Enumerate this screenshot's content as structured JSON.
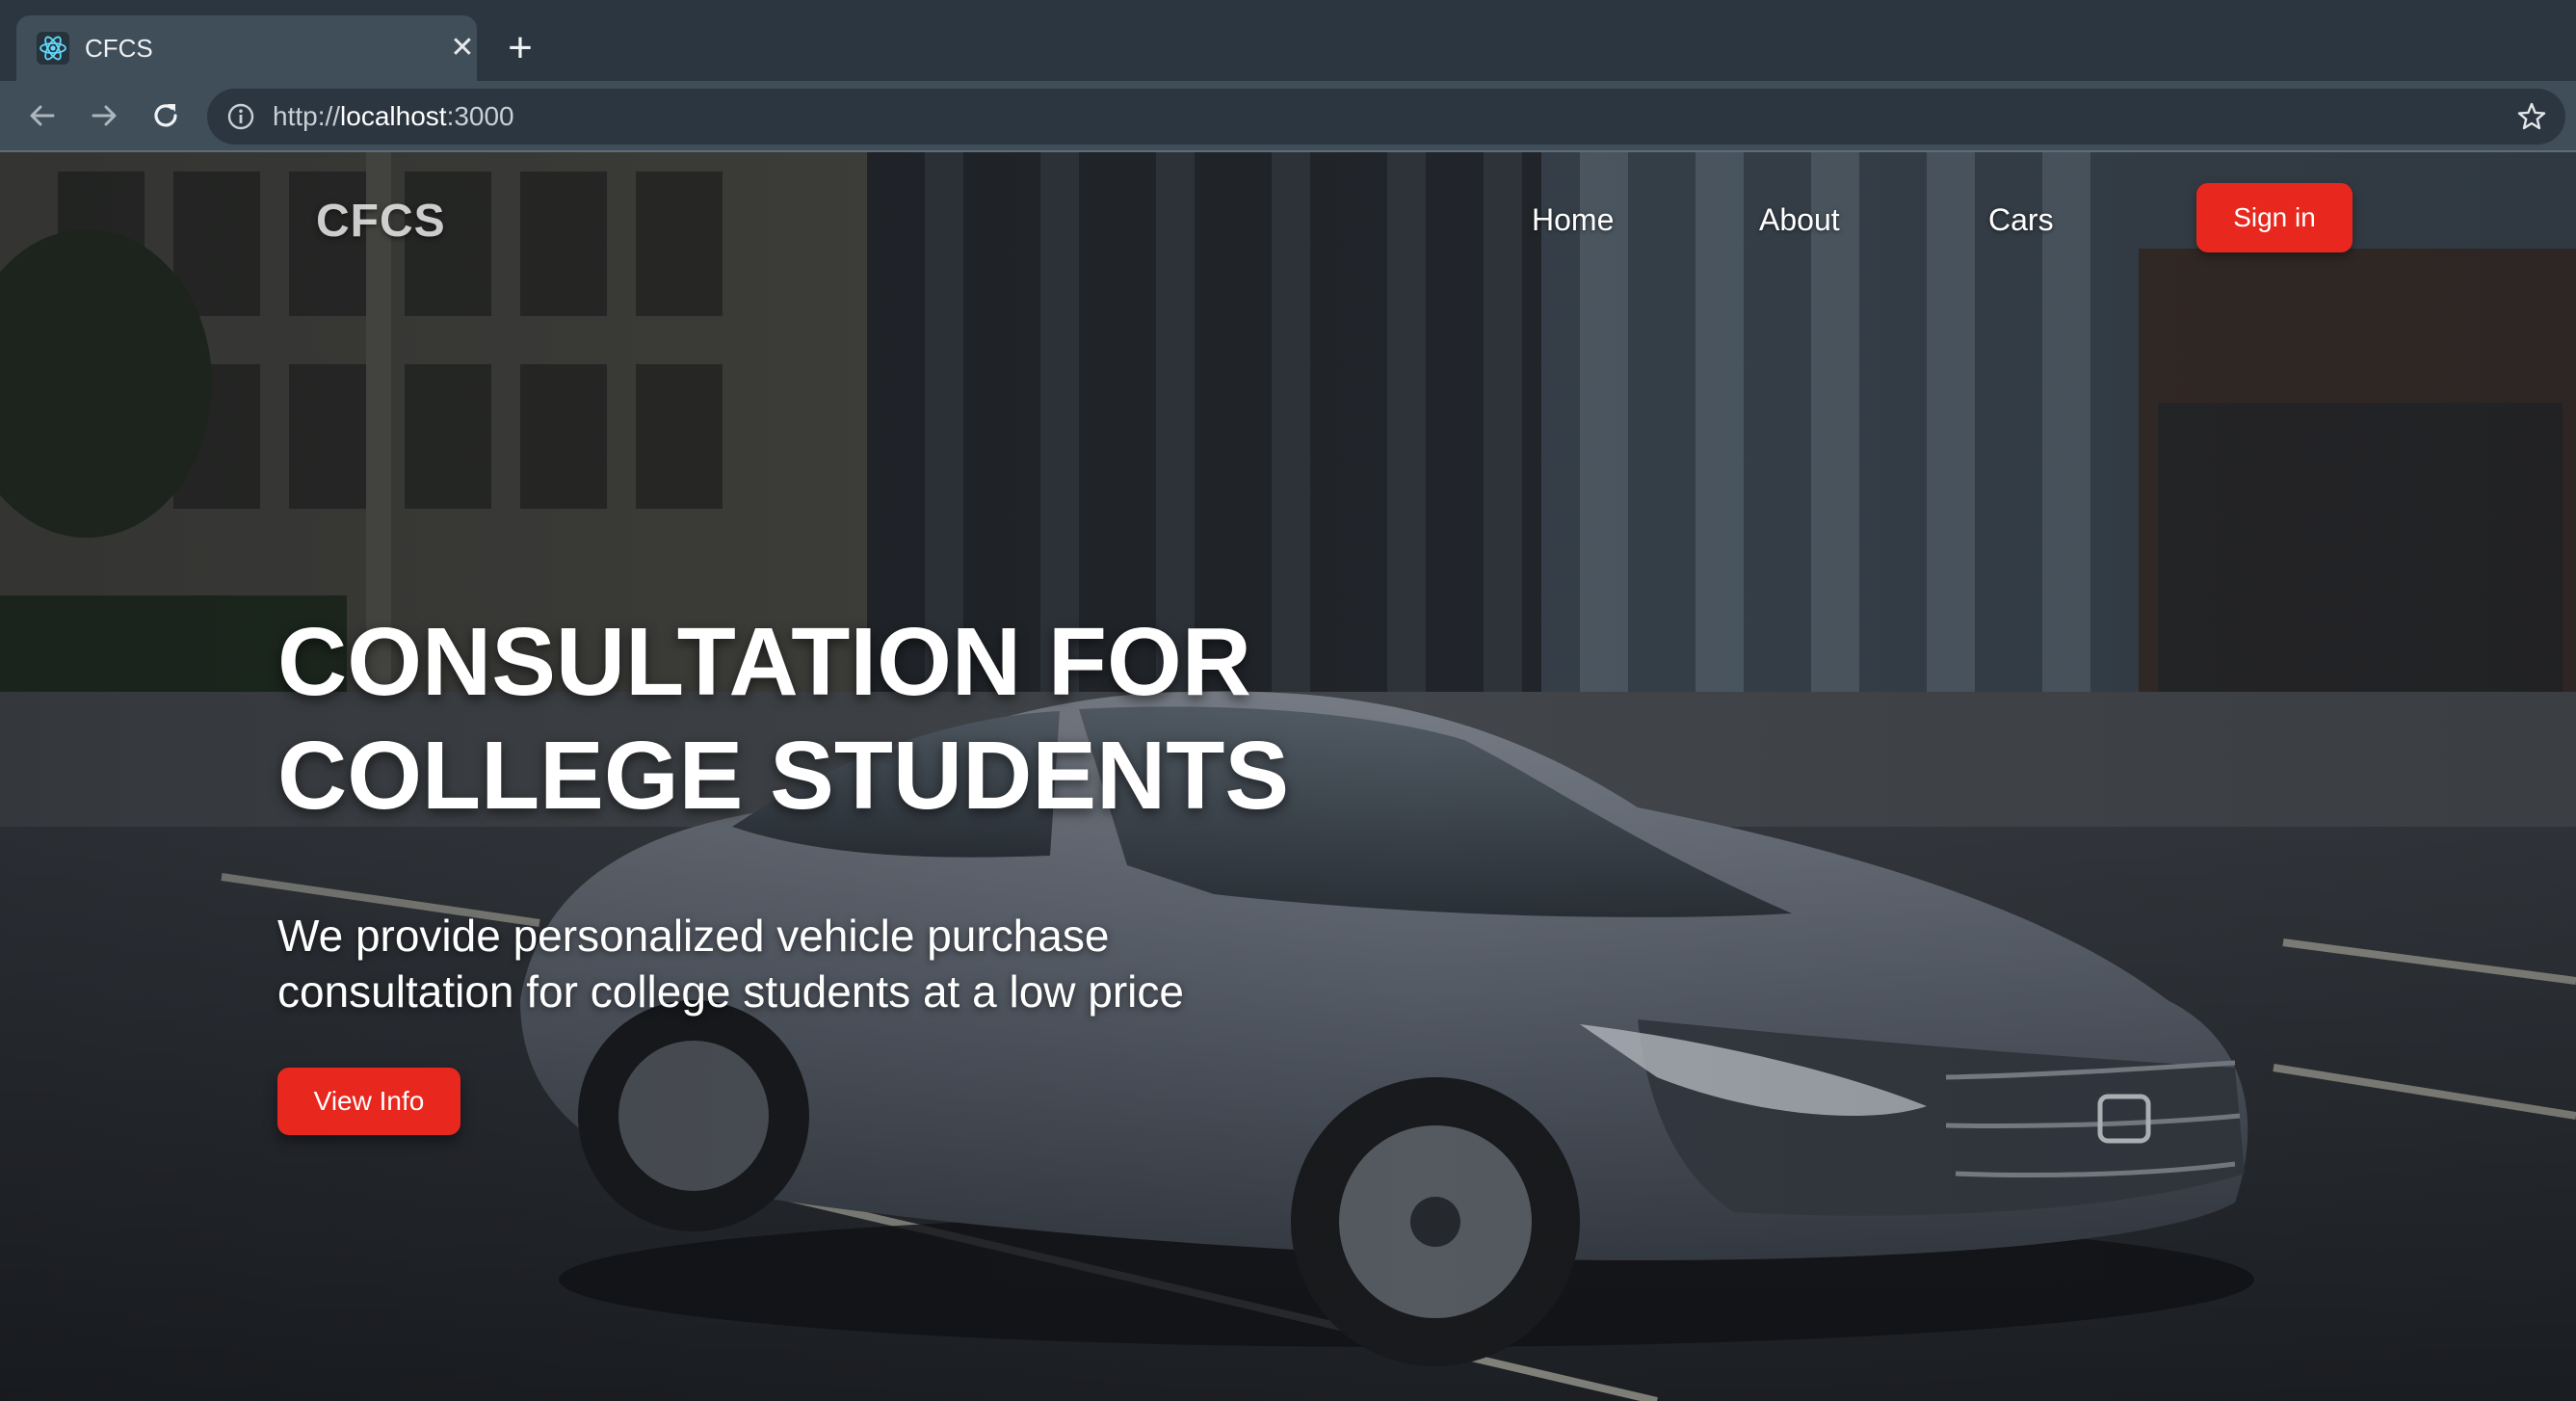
{
  "browser": {
    "tab_title": "CFCS",
    "tab_close": "✕",
    "new_tab": "+",
    "url_scheme": "http://",
    "url_host": "localhost",
    "url_port": ":3000"
  },
  "site": {
    "brand": "CFCS",
    "nav": {
      "home": "Home",
      "about": "About",
      "cars": "Cars"
    },
    "signin_label": "Sign in"
  },
  "hero": {
    "headline_line1": "CONSULTATION FOR",
    "headline_line2": "COLLEGE STUDENTS",
    "subtext_line1": "We provide personalized vehicle purchase",
    "subtext_line2": "consultation for college students at a low price",
    "cta_label": "View Info",
    "background": "sedan-on-city-street-photo"
  },
  "colors": {
    "accent": "#e8281e",
    "chrome_dark": "#2b3640",
    "chrome_light": "#404e59",
    "car_body": "#6c727d"
  },
  "icons": {
    "favicon": "react-atom-icon",
    "back": "arrow-left-icon",
    "forward": "arrow-right-icon",
    "reload": "reload-icon",
    "info": "info-circle-icon",
    "bookmark": "star-icon"
  }
}
